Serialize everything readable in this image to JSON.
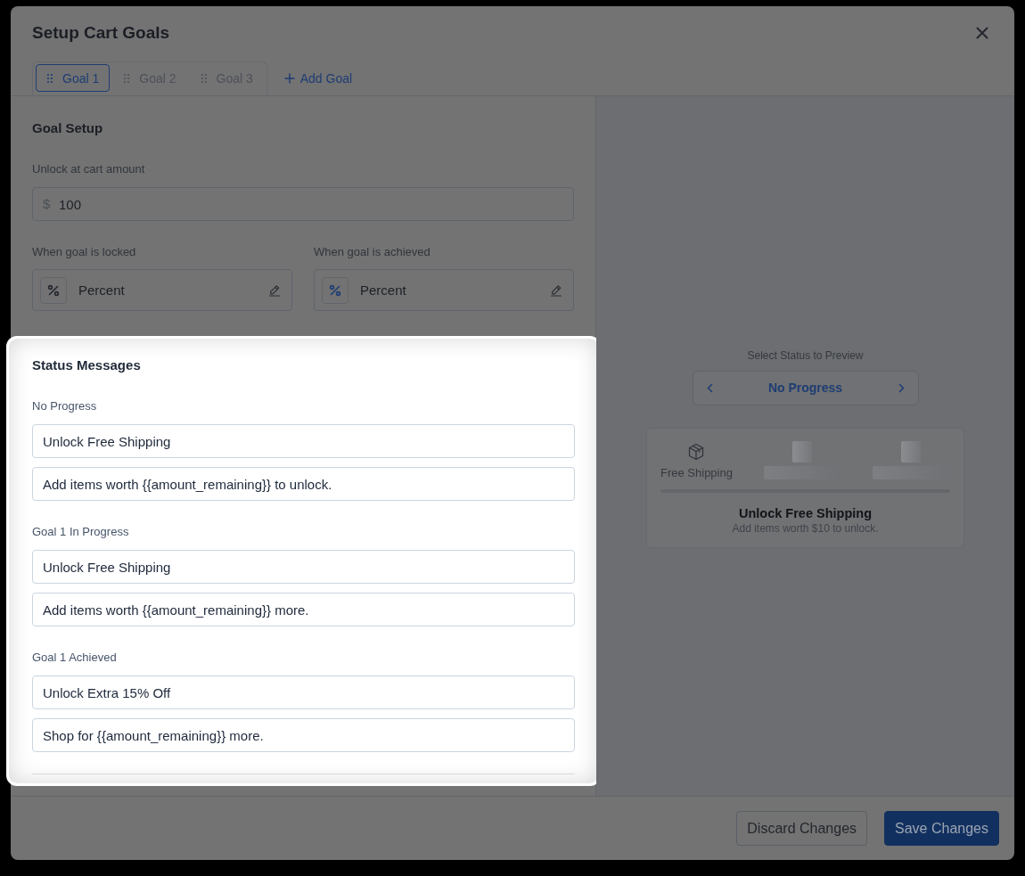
{
  "window": {
    "title": "Setup Cart Goals"
  },
  "tabs": [
    {
      "label": "Goal 1",
      "selected": true
    },
    {
      "label": "Goal 2",
      "selected": false
    },
    {
      "label": "Goal 3",
      "selected": false
    }
  ],
  "add_goal": "Add Goal",
  "goal_setup": {
    "title": "Goal Setup",
    "cart_amount": {
      "label": "Unlock at cart amount",
      "prefix": "$",
      "value": "100"
    },
    "rewards": [
      {
        "label": "When goal is locked",
        "value": "Percent",
        "color": "#24282e"
      },
      {
        "label": "When goal is achieved",
        "value": "Percent",
        "color": "#1e3d73"
      }
    ]
  },
  "status_messages": {
    "title": "Status Messages",
    "groups": [
      {
        "label": "No Progress",
        "fields": [
          "Unlock Free Shipping",
          "Add items worth {{amount_remaining}} to unlock."
        ]
      },
      {
        "label": "Goal 1 In Progress",
        "fields": [
          "Unlock Free Shipping",
          "Add items worth {{amount_remaining}} more."
        ]
      },
      {
        "label": "Goal 1 Achieved",
        "fields": [
          "Unlock Extra 15% Off",
          "Shop for {{amount_remaining}} more."
        ]
      }
    ]
  },
  "preview": {
    "label": "Select Status to Preview",
    "status": "No Progress",
    "tiers": [
      {
        "kind": "reward",
        "label": "Free Shipping"
      },
      {
        "kind": "placeholder"
      },
      {
        "kind": "placeholder"
      }
    ],
    "progress": {
      "level": 0
    },
    "title": "Unlock Free Shipping",
    "message": "Add items worth $10 to unlock."
  },
  "buttons": [
    {
      "label": "Discard Changes",
      "kind": "secondary"
    },
    {
      "label": "Save Changes",
      "kind": "primary"
    }
  ]
}
